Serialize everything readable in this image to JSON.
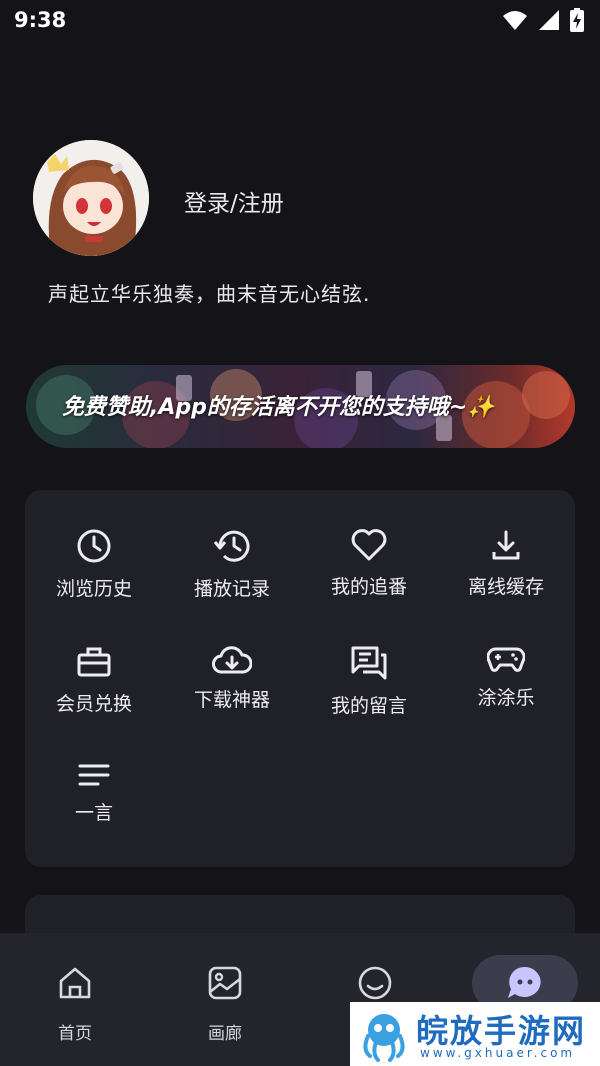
{
  "status_bar": {
    "time": "9:38",
    "icons": [
      "wifi-icon",
      "signal-icon",
      "battery-charging-icon"
    ]
  },
  "profile": {
    "avatar": "anime-girl-avatar",
    "login_label": "登录/注册",
    "motto": "声起立华乐独奏，曲末音无心结弦."
  },
  "banner": {
    "text": "免费赞助,App的存活离不开您的支持哦~✨"
  },
  "menu": {
    "items": [
      {
        "label": "浏览历史",
        "icon": "clock-icon"
      },
      {
        "label": "播放记录",
        "icon": "history-icon"
      },
      {
        "label": "我的追番",
        "icon": "heart-icon"
      },
      {
        "label": "离线缓存",
        "icon": "download-icon"
      },
      {
        "label": "会员兑换",
        "icon": "gift-card-icon"
      },
      {
        "label": "下载神器",
        "icon": "cloud-download-icon"
      },
      {
        "label": "我的留言",
        "icon": "comments-icon"
      },
      {
        "label": "涂涂乐",
        "icon": "gamepad-icon"
      },
      {
        "label": "一言",
        "icon": "text-lines-icon"
      }
    ]
  },
  "bottom_nav": {
    "items": [
      {
        "label": "首页",
        "icon": "home-icon"
      },
      {
        "label": "画廊",
        "icon": "gallery-icon"
      },
      {
        "label": "",
        "icon": "smile-icon"
      },
      {
        "label": "",
        "icon": "chat-bubble-icon",
        "active": true
      }
    ]
  },
  "watermark": {
    "title": "皖放手游网",
    "url": "www.gxhuaer.com"
  },
  "colors": {
    "background": "#131318",
    "card": "#202027",
    "nav": "#24242c",
    "active_pill": "#3c3d4c",
    "active_icon": "#c9c6ff"
  }
}
